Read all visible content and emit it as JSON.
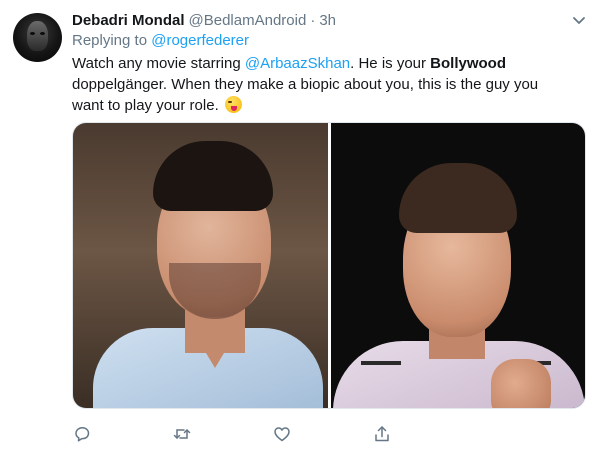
{
  "tweet": {
    "display_name": "Debadri Mondal",
    "handle": "@BedlamAndroid",
    "separator": "·",
    "time": "3h",
    "reply_prefix": "Replying to",
    "reply_to": "@rogerfederer",
    "text": {
      "line1_a": "Watch any movie starring ",
      "line1_mention": "@ArbaazSkhan",
      "line1_b": ". He is your ",
      "line1_bold": "Bollywood",
      "line2": " doppelgänger.  When they make a biopic about you, this is the guy you",
      "line3": "want to play your role. "
    }
  },
  "icons": {
    "avatar": "avatar",
    "caret": "chevron-down-icon",
    "reply": "reply-icon",
    "retweet": "retweet-icon",
    "like": "heart-icon",
    "share": "share-icon",
    "emoji": "winking-tongue-emoji"
  },
  "colors": {
    "link": "#1da1f2",
    "secondary_text": "#657786",
    "primary_text": "#14171a"
  }
}
